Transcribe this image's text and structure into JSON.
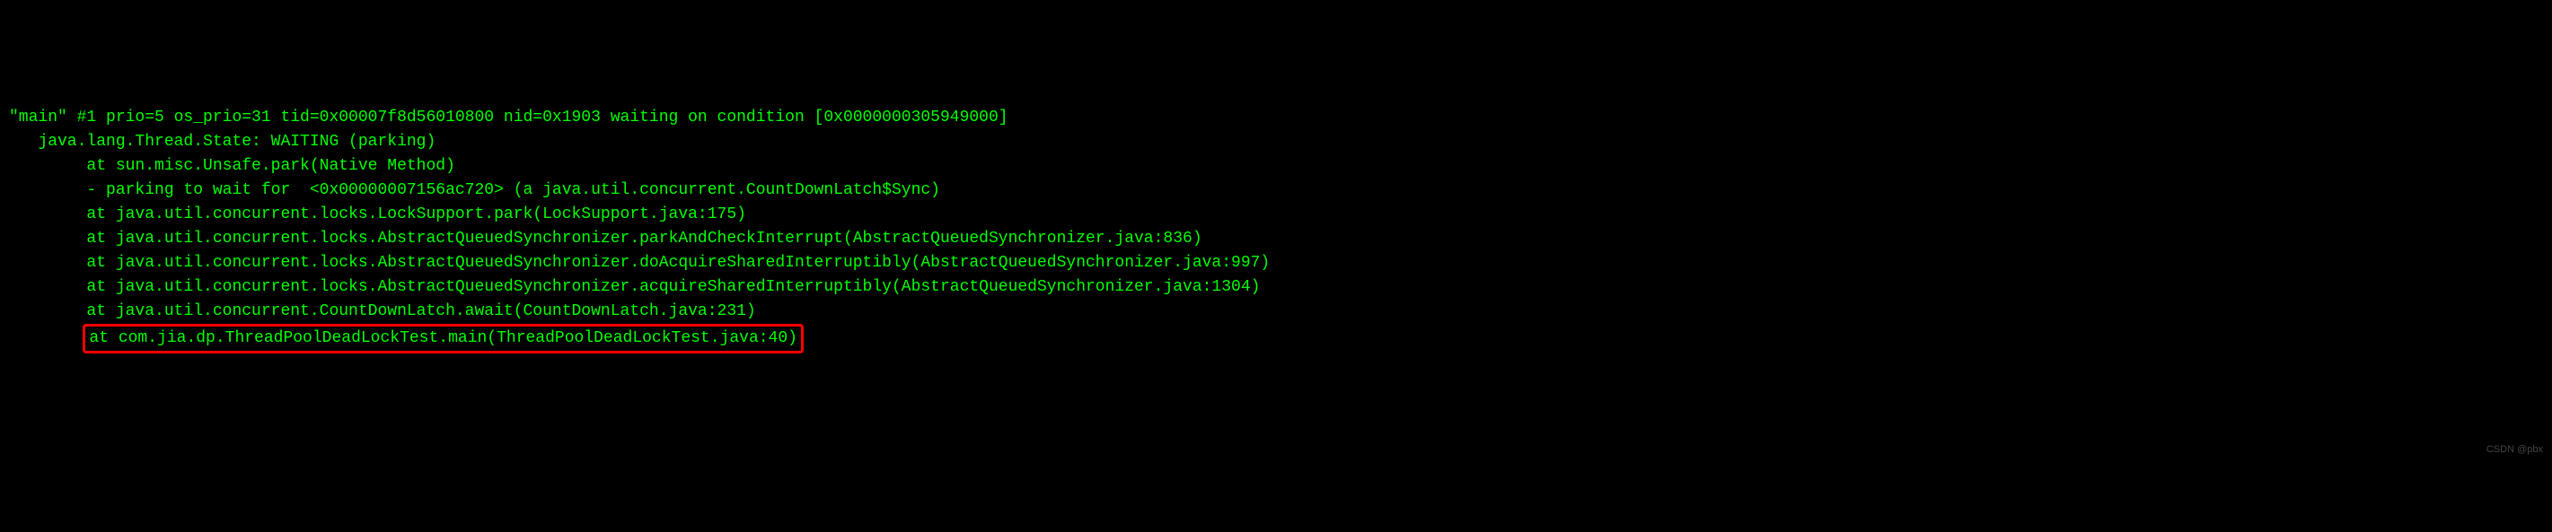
{
  "thread_dump": {
    "header": "\"main\" #1 prio=5 os_prio=31 tid=0x00007f8d56010800 nid=0x1903 waiting on condition [0x0000000305949000]",
    "state": "   java.lang.Thread.State: WAITING (parking)",
    "lines": [
      "        at sun.misc.Unsafe.park(Native Method)",
      "        - parking to wait for  <0x00000007156ac720> (a java.util.concurrent.CountDownLatch$Sync)",
      "        at java.util.concurrent.locks.LockSupport.park(LockSupport.java:175)",
      "        at java.util.concurrent.locks.AbstractQueuedSynchronizer.parkAndCheckInterrupt(AbstractQueuedSynchronizer.java:836)",
      "        at java.util.concurrent.locks.AbstractQueuedSynchronizer.doAcquireSharedInterruptibly(AbstractQueuedSynchronizer.java:997)",
      "        at java.util.concurrent.locks.AbstractQueuedSynchronizer.acquireSharedInterruptibly(AbstractQueuedSynchronizer.java:1304)",
      "        at java.util.concurrent.CountDownLatch.await(CountDownLatch.java:231)"
    ],
    "highlighted_prefix": "        ",
    "highlighted_line": "at com.jia.dp.ThreadPoolDeadLockTest.main(ThreadPoolDeadLockTest.java:40)"
  },
  "watermark": "CSDN @pbx"
}
